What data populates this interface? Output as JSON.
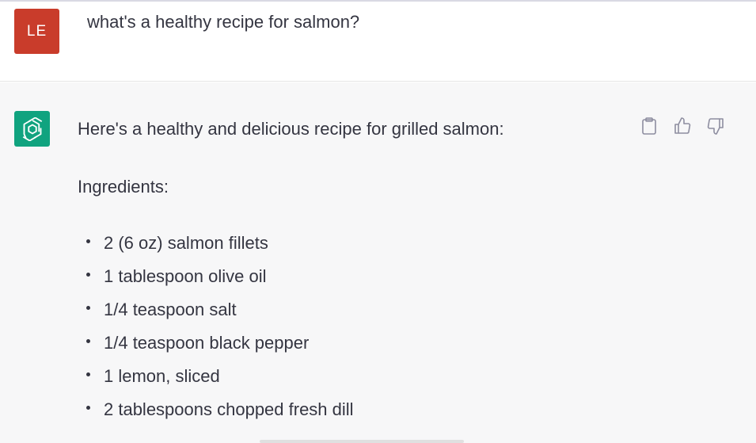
{
  "user_message": {
    "avatar_initials": "LE",
    "text": "what's a healthy recipe for salmon?"
  },
  "assistant_message": {
    "intro": "Here's a healthy and delicious recipe for grilled salmon:",
    "ingredients_heading": "Ingredients:",
    "ingredients": [
      "2 (6 oz) salmon fillets",
      "1 tablespoon olive oil",
      "1/4 teaspoon salt",
      "1/4 teaspoon black pepper",
      "1 lemon, sliced",
      "2 tablespoons chopped fresh dill"
    ]
  },
  "actions": {
    "icons": [
      "clipboard-icon",
      "thumbs-up-icon",
      "thumbs-down-icon"
    ]
  },
  "colors": {
    "user_avatar_bg": "#c93c2b",
    "bot_avatar_bg": "#10a37f",
    "assistant_row_bg": "#f7f7f8",
    "text": "#343541",
    "icon": "#8e8ea0"
  }
}
